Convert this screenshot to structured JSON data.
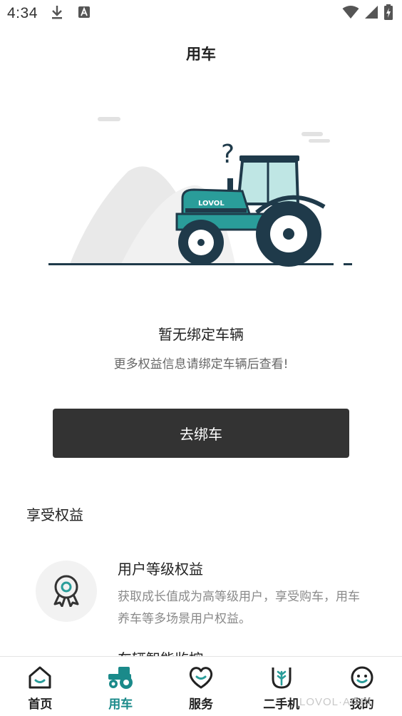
{
  "status_bar": {
    "time": "4:34",
    "icons": [
      "download-icon",
      "a-badge-icon",
      "wifi-icon",
      "signal-icon",
      "battery-icon"
    ]
  },
  "header": {
    "title": "用车"
  },
  "illustration": {
    "brand_text": "LOVOL",
    "question_mark": "?",
    "accent_color": "#2a9d9a",
    "dark_color": "#1f3a4a"
  },
  "empty_state": {
    "title": "暂无绑定车辆",
    "subtitle": "更多权益信息请绑定车辆后查看!"
  },
  "bind_button": {
    "label": "去绑车"
  },
  "benefits": {
    "section_title": "享受权益",
    "items": [
      {
        "icon": "medal-icon",
        "title": "用户等级权益",
        "description": "获取成长值成为高等级用户，享受购车，用车养车等多场景用户权益。"
      }
    ],
    "partial_title": "车辆智能监控"
  },
  "bottom_nav": {
    "items": [
      {
        "label": "首页",
        "icon": "home-icon",
        "active": false
      },
      {
        "label": "用车",
        "icon": "tractor-icon",
        "active": true
      },
      {
        "label": "服务",
        "icon": "heart-service-icon",
        "active": false
      },
      {
        "label": "二手机",
        "icon": "wheat-icon",
        "active": false
      },
      {
        "label": "我的",
        "icon": "profile-face-icon",
        "active": false
      }
    ],
    "active_color": "#1a8a8a"
  },
  "watermark": "LOVOL·AGRI"
}
